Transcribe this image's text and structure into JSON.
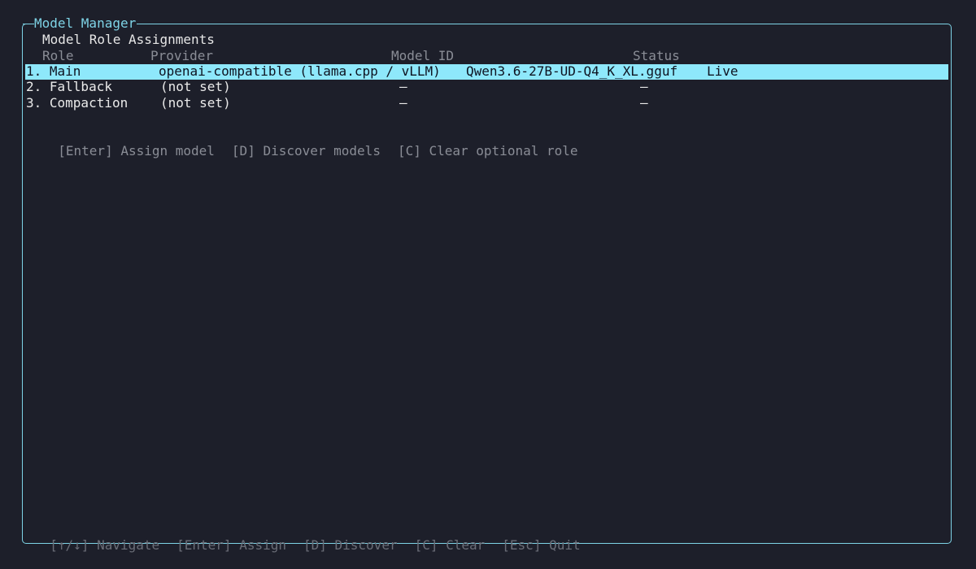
{
  "panel": {
    "title": "Model Manager",
    "section_title": "Model Role Assignments"
  },
  "table": {
    "headers": {
      "role": "Role",
      "provider": "Provider",
      "model_id": "Model ID",
      "status": "Status"
    },
    "rows": [
      {
        "role": "1. Main",
        "provider": "openai-compatible (llama.cpp / vLLM)",
        "model_id": "Qwen3.6-27B-UD-Q4_K_XL.gguf",
        "status": "Live",
        "selected": true
      },
      {
        "role": "2. Fallback",
        "provider": "(not set)",
        "model_id": "—",
        "status": "—",
        "selected": false
      },
      {
        "role": "3. Compaction",
        "provider": "(not set)",
        "model_id": "—",
        "status": "—",
        "selected": false
      }
    ]
  },
  "help": {
    "assign": "[Enter] Assign model",
    "discover": "[D] Discover models",
    "clear": "[C] Clear optional role"
  },
  "footer": {
    "navigate": "[↑/↓] Navigate",
    "assign": "[Enter] Assign",
    "discover": "[D] Discover",
    "clear": "[C] Clear",
    "quit": "[Esc] Quit"
  },
  "colors": {
    "accent": "#7ed3e6",
    "selection_bg": "#8ee8fb",
    "background": "#1d1f2a"
  }
}
